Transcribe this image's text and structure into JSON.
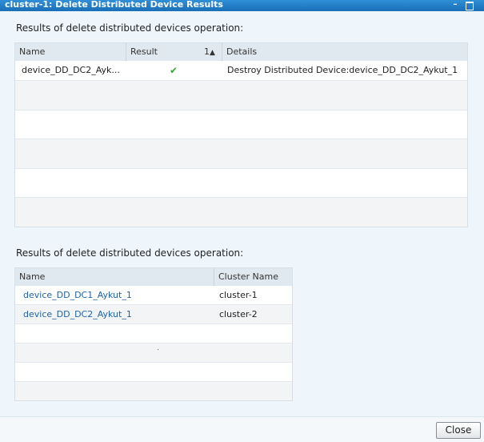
{
  "window": {
    "title": "cluster-1: Delete Distributed Device Results",
    "min_glyph": "–"
  },
  "section1": {
    "label": "Results of delete distributed devices operation:",
    "columns": {
      "name": "Name",
      "result": "Result",
      "sort_order": "1",
      "sort_arrow": "▲",
      "details": "Details"
    },
    "rows": [
      {
        "name": "device_DD_DC2_Ayk...",
        "result_icon": "checkmark-icon",
        "result_glyph": "✔",
        "details": "Destroy Distributed Device:device_DD_DC2_Aykut_1"
      }
    ]
  },
  "section2": {
    "label": "Results of delete distributed devices operation:",
    "columns": {
      "name": "Name",
      "cluster_name": "Cluster Name"
    },
    "rows": [
      {
        "name": "device_DD_DC1_Aykut_1",
        "cluster": "cluster-1"
      },
      {
        "name": "device_DD_DC2_Aykut_1",
        "cluster": "cluster-2"
      }
    ]
  },
  "footer": {
    "close_label": "Close"
  },
  "colors": {
    "titlebar": "#1a6fb8",
    "link": "#1f63a8",
    "check": "#3aa635",
    "header_bg": "#e1e9f0"
  }
}
